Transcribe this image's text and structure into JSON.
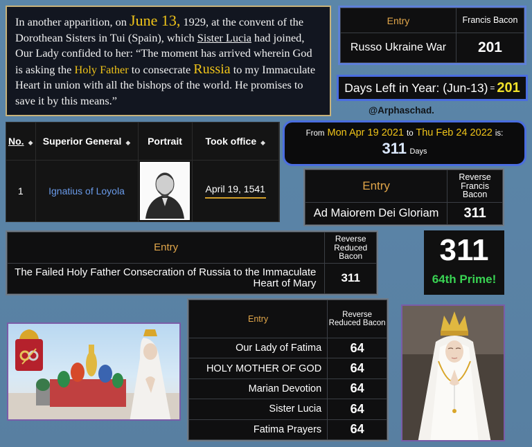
{
  "quote": {
    "p1": "In another apparition, on",
    "date_big": "June 13,",
    "p2": " 1929, at the convent of the Dorothean Sisters in Tui (Spain), which ",
    "sister": "Sister Lucia",
    "p3": " had joined, Our Lady confided to her: “The moment has arrived wherein God is asking the ",
    "holy_father": "Holy Father",
    "p4": " to consecrate ",
    "russia": "Russia",
    "p5": " to my Immaculate Heart in union with all the bishops of the world. He promises to save it by this means.”"
  },
  "russo_table": {
    "header_entry": "Entry",
    "header_cipher": "Francis Bacon",
    "row_entry": "Russo Ukraine War",
    "row_value": "201"
  },
  "days_left": {
    "label": "Days Left in Year: (Jun-13)",
    "eq": "=",
    "value": "201"
  },
  "handle": "@Arphaschad.",
  "superior_table": {
    "headers": [
      "No.",
      "Superior General",
      "Portrait",
      "Took office"
    ],
    "sort_glyph": "◆",
    "row": {
      "no": "1",
      "name": "Ignatius of Loyola",
      "took_office": "April 19, 1541"
    }
  },
  "date_range": {
    "from_label": "From",
    "from_date": "Mon Apr 19 2021",
    "to_label": "to",
    "to_date": "Thu Feb 24 2022",
    "is_label": "is:",
    "value": "311",
    "unit": "Days"
  },
  "amdg_table": {
    "header_entry": "Entry",
    "header_cipher": "Reverse Francis Bacon",
    "row_entry": "Ad Maiorem Dei Gloriam",
    "row_value": "311"
  },
  "failed_table": {
    "header_entry": "Entry",
    "header_cipher": "Reverse Reduced Bacon",
    "row_entry": "The Failed Holy Father Consecration of Russia to the Immaculate Heart of Mary",
    "row_value": "311"
  },
  "prime_box": {
    "value": "311",
    "label": "64th Prime!"
  },
  "t64_table": {
    "header_entry": "Entry",
    "header_cipher": "Reverse Reduced Bacon",
    "rows": [
      {
        "entry": "Our Lady of Fatima",
        "value": "64"
      },
      {
        "entry": "HOLY MOTHER OF GOD",
        "value": "64"
      },
      {
        "entry": "Marian Devotion",
        "value": "64"
      },
      {
        "entry": "Sister Lucia",
        "value": "64"
      },
      {
        "entry": "Fatima Prayers",
        "value": "64"
      }
    ]
  },
  "colors": {
    "gold": "#f0c419",
    "accent_blue": "#4a6de0",
    "prime_green": "#39d353",
    "link_blue": "#6a9bea"
  }
}
